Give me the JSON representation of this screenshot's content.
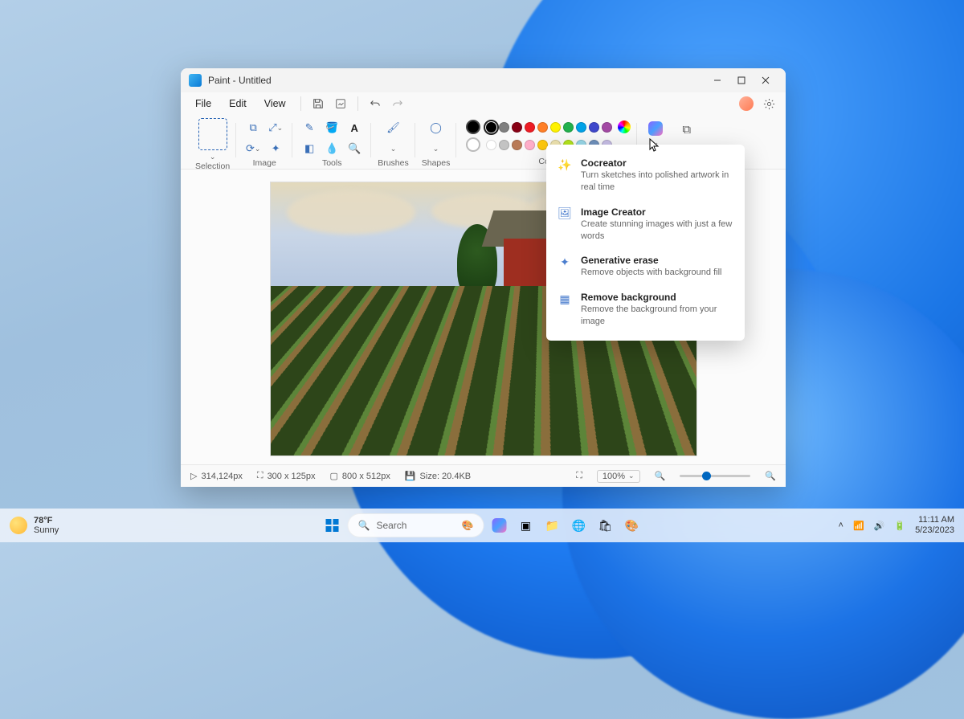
{
  "window": {
    "title": "Paint - Untitled"
  },
  "menubar": {
    "file": "File",
    "edit": "Edit",
    "view": "View"
  },
  "ribbon": {
    "selection_label": "Selection",
    "image_label": "Image",
    "tools_label": "Tools",
    "brushes_label": "Brushes",
    "shapes_label": "Shapes",
    "color_label": "Color"
  },
  "colors_row1": [
    "#000000",
    "#7f7f7f",
    "#880015",
    "#ed1c24",
    "#ff7f27",
    "#fff200",
    "#22b14c",
    "#00a2e8",
    "#3f48cc",
    "#a349a4"
  ],
  "colors_row2": [
    "#ffffff",
    "#c3c3c3",
    "#b97a57",
    "#ffaec9",
    "#ffc90e",
    "#efe4b0",
    "#b5e61d",
    "#99d9ea",
    "#7092be",
    "#c8bfe7"
  ],
  "copilot_menu": [
    {
      "title": "Cocreator",
      "desc": "Turn sketches into polished artwork in real time"
    },
    {
      "title": "Image Creator",
      "desc": "Create stunning images with just a few words"
    },
    {
      "title": "Generative erase",
      "desc": "Remove objects with background fill"
    },
    {
      "title": "Remove background",
      "desc": "Remove the background from your image"
    }
  ],
  "status": {
    "cursor_pos": "314,124px",
    "selection_size": "300  x  125px",
    "canvas_size": "800  x  512px",
    "file_size": "Size: 20.4KB",
    "zoom": "100%"
  },
  "taskbar": {
    "temp": "78°F",
    "condition": "Sunny",
    "search_placeholder": "Search",
    "time": "11:11 AM",
    "date": "5/23/2023"
  }
}
